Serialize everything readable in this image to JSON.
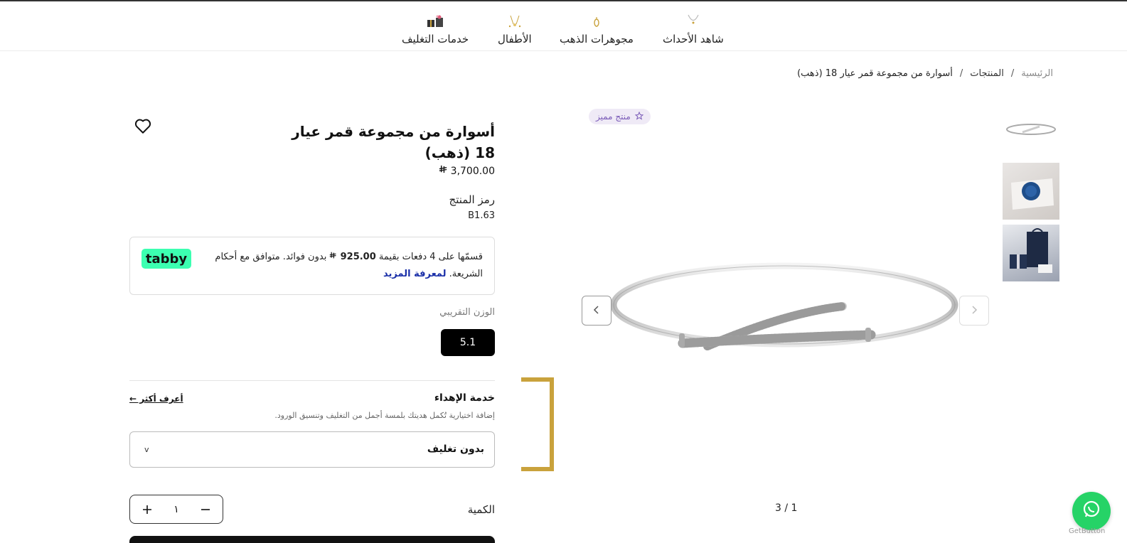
{
  "nav": {
    "items": [
      {
        "label": "شاهد الأحداث",
        "icon": "necklace-icon"
      },
      {
        "label": "مجوهرات الذهب",
        "icon": "earring-icon"
      },
      {
        "label": "الأطفال",
        "icon": "kids-jewelry-icon"
      },
      {
        "label": "خدمات التغليف",
        "icon": "gift-box-icon"
      }
    ]
  },
  "breadcrumb": {
    "home": "الرئيسية",
    "separator": "/",
    "products": "المنتجات",
    "current": "أسوارة من مجموعة قمر عيار 18 (ذهب)"
  },
  "gallery": {
    "badge": "منتج مميز",
    "counter": "3 / 1"
  },
  "product": {
    "title": "أسوارة من مجموعة قمر عيار 18 (ذهب)",
    "price": "3,700.00",
    "currency_symbol": "⃁",
    "sku_label": "رمز المنتج",
    "sku_value": "B1.63"
  },
  "tabby": {
    "text_pre": "قسمّها على 4 دفعات بقيمة",
    "amount": "925.00",
    "text_post": "بدون فوائد. متوافق مع أحكام الشريعة.",
    "link": "لمعرفة المزيد",
    "logo": "tabby"
  },
  "weight": {
    "label": "الوزن التقريبي",
    "value": "5.1"
  },
  "gift": {
    "title": "خدمة الإهداء",
    "learn_more": "أعرف أكثر ←",
    "description": "إضافة اختيارية تُكمل هديتك بلمسة أجمل من التغليف وتنسيق الورود.",
    "selected": "بدون تغليف",
    "caret": "v"
  },
  "quantity": {
    "label": "الكمية",
    "value": "١"
  },
  "widgets": {
    "getbutton": "GetButton"
  },
  "colors": {
    "accent_gold": "#c9a23c",
    "tabby_green": "#3cffb1",
    "whatsapp_green": "#26d367",
    "badge_purple": "#7b5cb8"
  }
}
